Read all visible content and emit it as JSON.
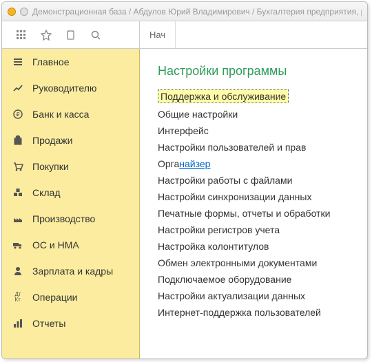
{
  "window": {
    "title": "Демонстрационная база / Абдулов Юрий Владимирович / Бухгалтерия предприятия, р"
  },
  "toolbar": {
    "tab_label": "Нач"
  },
  "sidebar": {
    "items": [
      {
        "label": "Главное",
        "icon": "menu"
      },
      {
        "label": "Руководителю",
        "icon": "trend"
      },
      {
        "label": "Банк и касса",
        "icon": "ruble"
      },
      {
        "label": "Продажи",
        "icon": "bag"
      },
      {
        "label": "Покупки",
        "icon": "cart"
      },
      {
        "label": "Склад",
        "icon": "boxes"
      },
      {
        "label": "Производство",
        "icon": "factory"
      },
      {
        "label": "ОС и НМА",
        "icon": "truck"
      },
      {
        "label": "Зарплата и кадры",
        "icon": "person"
      },
      {
        "label": "Операции",
        "icon": "dtkt"
      },
      {
        "label": "Отчеты",
        "icon": "chart"
      }
    ]
  },
  "main": {
    "section_title": "Настройки программы",
    "links": [
      "Поддержка и обслуживание",
      "Общие настройки",
      "Интерфейс",
      "Настройки пользователей и прав",
      "Органайзер",
      "Настройки работы с файлами",
      "Настройки синхронизации данных",
      "Печатные формы, отчеты и обработки",
      "Настройки регистров учета",
      "Настройка колонтитулов",
      "Обмен электронными документами",
      "Подключаемое оборудование",
      "Настройки актуализации данных",
      "Интернет-поддержка пользователей"
    ],
    "organizer_prefix": "Орга",
    "organizer_link": "найзер"
  }
}
